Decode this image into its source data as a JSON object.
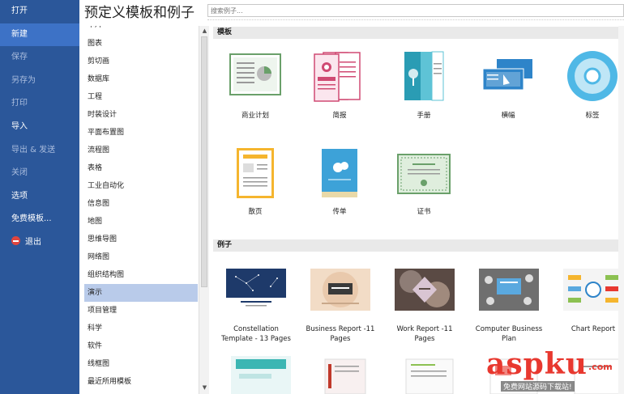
{
  "sidebar": {
    "items": [
      {
        "label": "打开",
        "style": "normal"
      },
      {
        "label": "新建",
        "style": "active"
      },
      {
        "label": "保存",
        "style": "dim"
      },
      {
        "label": "另存为",
        "style": "dim"
      },
      {
        "label": "打印",
        "style": "dim"
      },
      {
        "label": "导入",
        "style": "normal"
      },
      {
        "label": "导出 & 发送",
        "style": "dim"
      },
      {
        "label": "关闭",
        "style": "dim"
      },
      {
        "label": "选项",
        "style": "normal"
      },
      {
        "label": "免费模板...",
        "style": "normal"
      },
      {
        "label": "退出",
        "style": "normal",
        "icon": "exit-icon"
      }
    ]
  },
  "main": {
    "title": "预定义模板和例子",
    "search_placeholder": "搜索例子..."
  },
  "categories": {
    "items": [
      "卡片",
      "图表",
      "剪切画",
      "数据库",
      "工程",
      "时装设计",
      "平面布置图",
      "流程图",
      "表格",
      "工业自动化",
      "信息图",
      "地图",
      "思维导图",
      "网络图",
      "组织结构图",
      "演示",
      "项目管理",
      "科学",
      "软件",
      "线框图",
      "最近所用模板"
    ],
    "selected": "演示"
  },
  "templates": {
    "header": "模板",
    "items": [
      {
        "label": "商业计划",
        "icon": "business-plan-icon"
      },
      {
        "label": "简报",
        "icon": "newsletter-icon"
      },
      {
        "label": "手册",
        "icon": "brochure-icon"
      },
      {
        "label": "横幅",
        "icon": "banner-icon"
      },
      {
        "label": "标签",
        "icon": "cd-label-icon"
      },
      {
        "label": "散页",
        "icon": "flyer-icon"
      },
      {
        "label": "传单",
        "icon": "leaflet-icon"
      },
      {
        "label": "证书",
        "icon": "certificate-icon"
      }
    ]
  },
  "examples": {
    "header": "例子",
    "items": [
      {
        "line1": "Constellation",
        "line2": "Template - 13 Pages"
      },
      {
        "line1": "Business Report -11",
        "line2": "Pages"
      },
      {
        "line1": "Work Report -11",
        "line2": "Pages"
      },
      {
        "line1": "Computer Business",
        "line2": "Plan"
      },
      {
        "line1": "Chart Report",
        "line2": ""
      }
    ]
  },
  "watermark": {
    "logo": "aspku",
    "suffix": ".com",
    "subtitle": "免费网站源码下载站!"
  },
  "colors": {
    "sidebar": "#2b579a",
    "sidebar_active": "#3d72c6",
    "selected_category": "#b9cbea",
    "section_header": "#e9e9e9",
    "watermark": "#e8382f"
  }
}
